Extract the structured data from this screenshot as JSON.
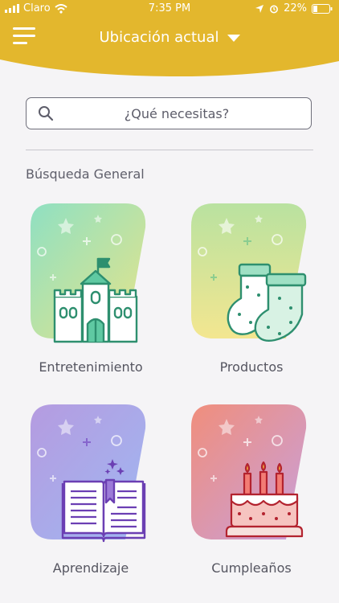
{
  "status": {
    "carrier": "Claro",
    "time": "7:35 PM",
    "battery": "22%"
  },
  "header": {
    "location_label": "Ubicación actual"
  },
  "search": {
    "placeholder": "¿Qué necesitas?"
  },
  "section": {
    "title": "Búsqueda General"
  },
  "categories": [
    {
      "label": "Entretenimiento",
      "icon": "castle-icon"
    },
    {
      "label": "Productos",
      "icon": "baby-socks-icon"
    },
    {
      "label": "Aprendizaje",
      "icon": "open-book-icon"
    },
    {
      "label": "Cumpleaños",
      "icon": "birthday-cake-icon"
    }
  ],
  "colors": {
    "header": "#e3b72d",
    "text": "#555560"
  }
}
